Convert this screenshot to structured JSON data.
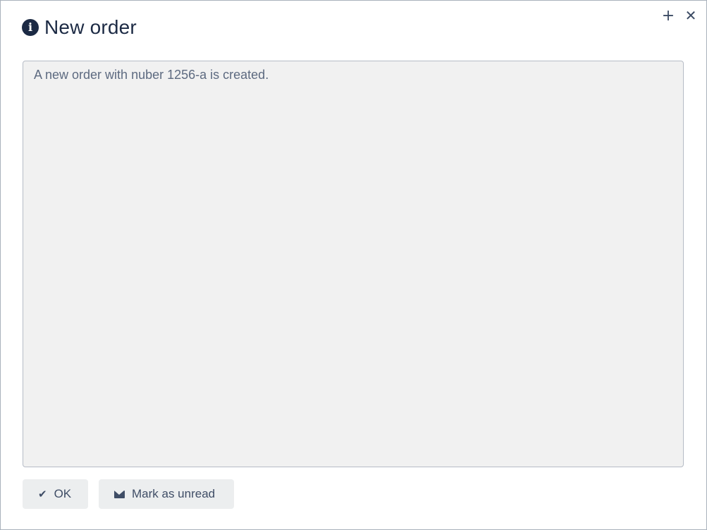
{
  "dialog": {
    "title": "New order",
    "window_controls": {
      "expand_icon": "plus-icon",
      "expand_glyph": "+",
      "close_icon": "close-icon",
      "close_glyph": "✕"
    },
    "message": "A new order with nuber 1256-a is created.",
    "buttons": {
      "ok_label": "OK",
      "ok_icon": "check-icon",
      "unread_label": "Mark as unread",
      "unread_icon": "envelope-icon"
    }
  },
  "colors": {
    "title_text": "#1c2a44",
    "message_bg": "#f1f1f1",
    "button_bg": "#eceeef",
    "button_text": "#3f4d66"
  }
}
